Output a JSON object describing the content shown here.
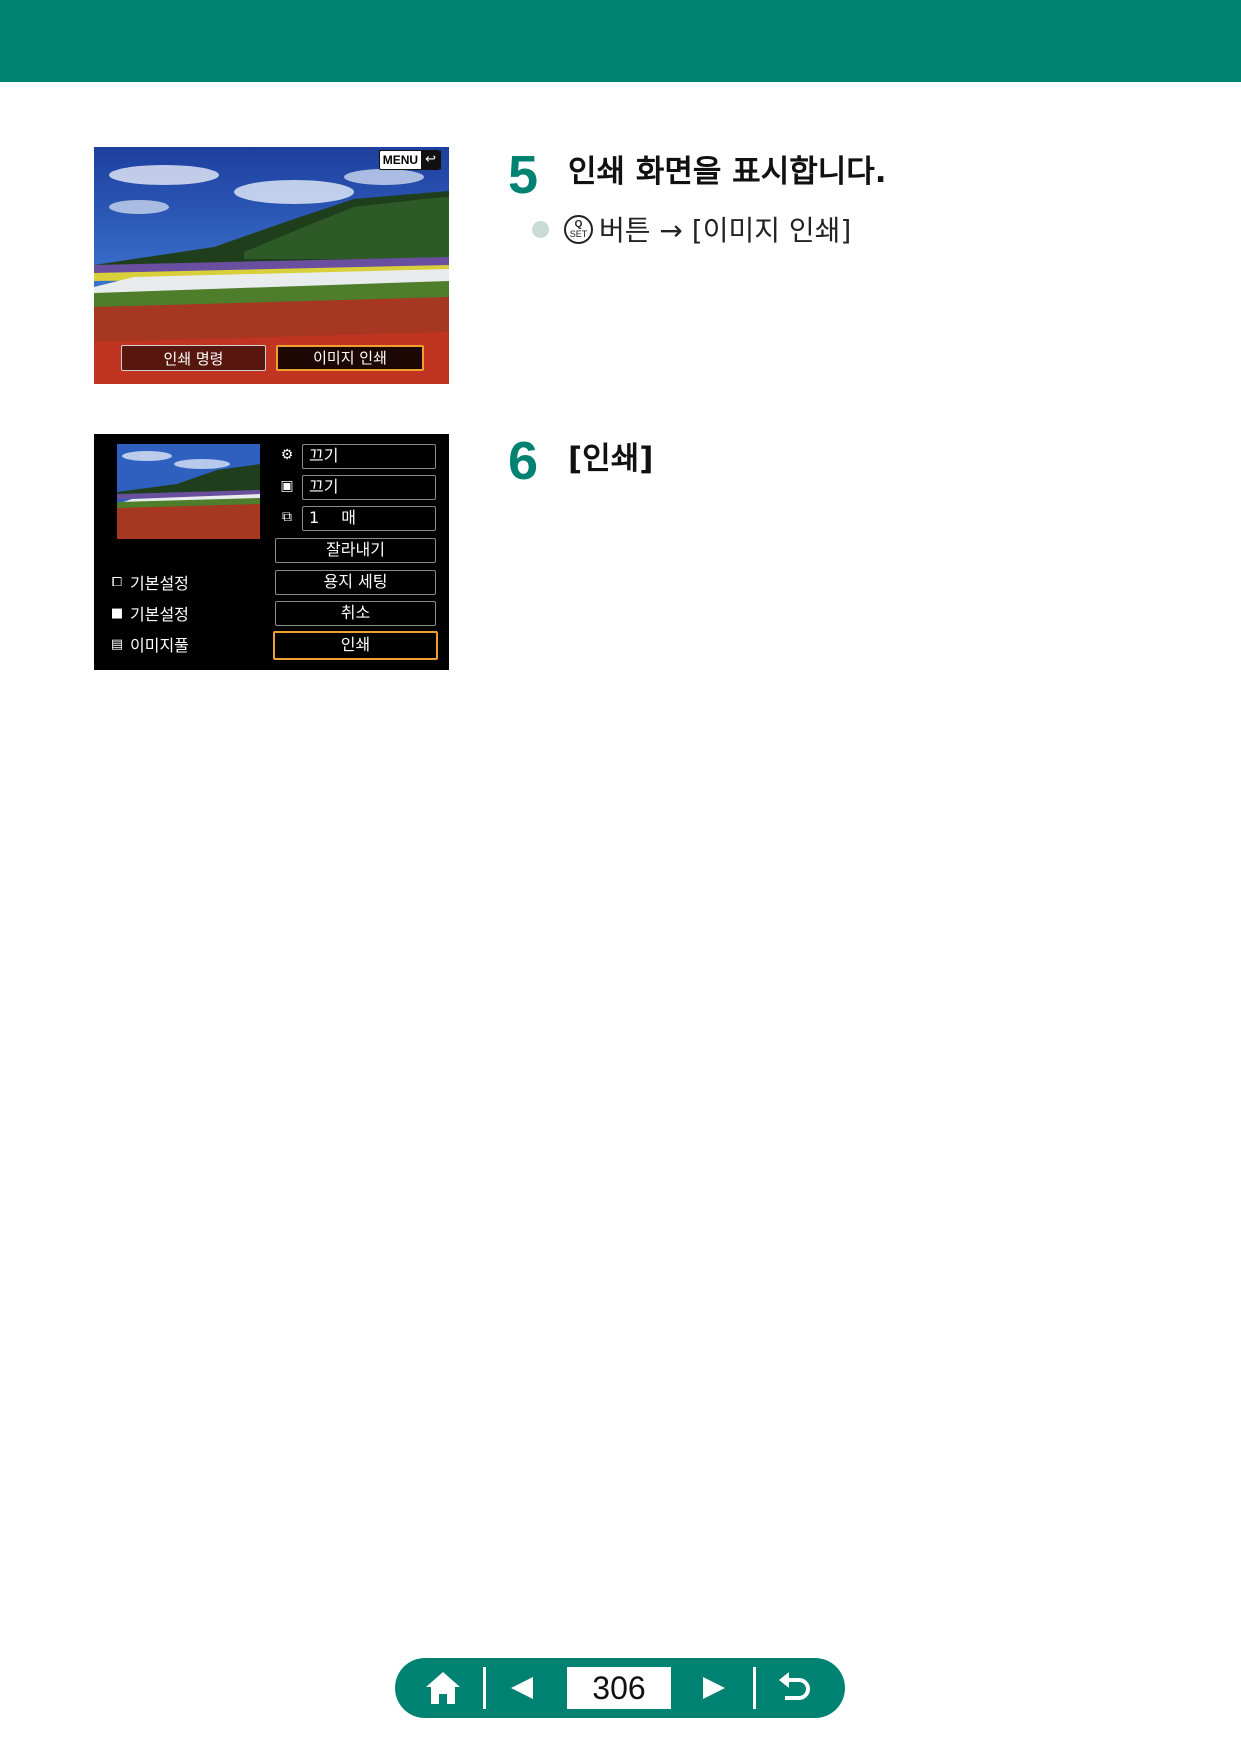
{
  "colors": {
    "brand": "#008272",
    "highlight": "#f0a030"
  },
  "screen1": {
    "menu_label": "MENU",
    "btn_print_order": "인쇄 명령",
    "btn_image_print": "이미지 인쇄"
  },
  "screen2": {
    "effect_value": "끄기",
    "date_value": "끄기",
    "qty_number": "1",
    "qty_unit": "매",
    "btn_trim": "잘라내기",
    "btn_paper": "용지 세팅",
    "btn_cancel": "취소",
    "btn_print": "인쇄",
    "side_items": [
      "기본설정",
      "기본설정",
      "이미지풀"
    ]
  },
  "step5": {
    "number": "5",
    "title": "인쇄 화면을 표시합니다.",
    "button_icon": "set-button-icon",
    "bullet_text": "버튼 → [이미지 인쇄]"
  },
  "step6": {
    "number": "6",
    "title": "[인쇄]"
  },
  "nav": {
    "page": "306",
    "icons": [
      "home-icon",
      "prev-icon",
      "next-icon",
      "return-icon"
    ]
  }
}
